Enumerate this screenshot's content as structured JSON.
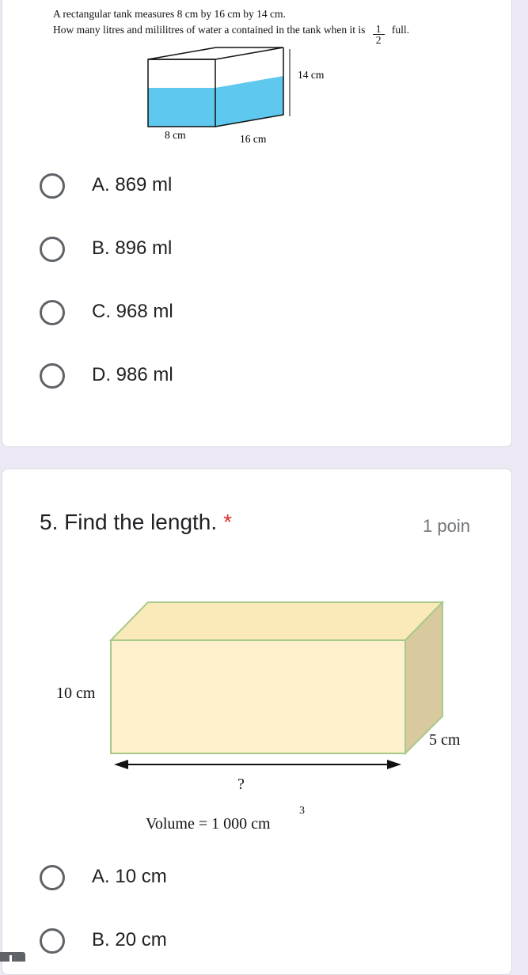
{
  "question4": {
    "prompt_line1": "A rectangular tank measures 8 cm by 16 cm by 14 cm.",
    "prompt_line2_a": "How many  litres and mililitres of water a contained in the tank when it is",
    "fraction_numerator": "1",
    "fraction_denominator": "2",
    "prompt_line2_b": "full.",
    "diagram": {
      "label_height": "14 cm",
      "label_width": "8 cm",
      "label_length": "16 cm",
      "water_color": "#5ec8ee"
    },
    "options": [
      {
        "label": "A. 869 ml"
      },
      {
        "label": "B. 896 ml"
      },
      {
        "label": "C. 968 ml"
      },
      {
        "label": "D. 986 ml"
      }
    ]
  },
  "question5": {
    "title": "5. Find the length.",
    "required_marker": "*",
    "points": "1 poin",
    "diagram": {
      "label_height": "10 cm",
      "label_depth": "5 cm",
      "label_length": "?",
      "volume_text": "Volume = 1 000 cm",
      "volume_exponent": "3",
      "face_color": "#fdf0cc",
      "top_color": "#fbeab9",
      "side_color": "#d8ca9e",
      "edge_color": "#a8c98a"
    },
    "options": [
      {
        "label": "A. 10 cm"
      },
      {
        "label": "B. 20 cm"
      }
    ]
  },
  "colors": {
    "background": "#ece9f5",
    "required": "#d93025",
    "radio_border": "#5f6368"
  }
}
